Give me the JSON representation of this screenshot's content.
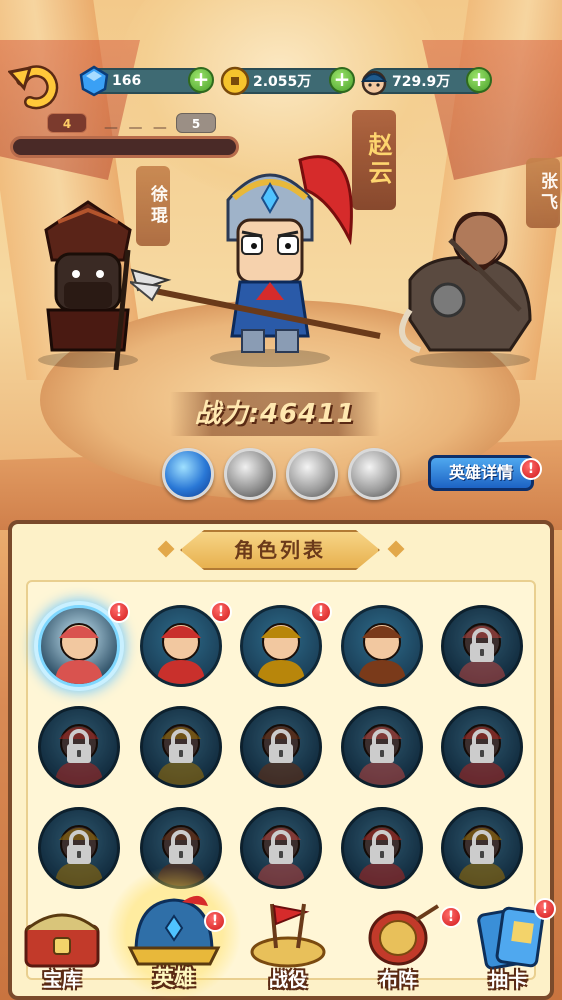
{
  "resources": [
    {
      "icon": "gem-icon",
      "value": "166"
    },
    {
      "icon": "coin-icon",
      "value": "2.055万"
    },
    {
      "icon": "soldier-icon",
      "value": "729.9万"
    }
  ],
  "level": {
    "current": "4",
    "dots": "— — —",
    "next": "5"
  },
  "heroes": {
    "center_name": "赵云",
    "left_name": "徐琨",
    "right_name": "张飞"
  },
  "power": {
    "label": "战力:",
    "value": "46411"
  },
  "skills": [
    "lightning-skill-icon",
    "whirlwind-skill-icon",
    "shield-skill-icon",
    "heal-skill-icon"
  ],
  "detail_button": "英雄详情",
  "badge_text": "!",
  "roster": {
    "title": "角色列表",
    "slots": [
      {
        "name": "hero-slot-1",
        "locked": false,
        "selected": true,
        "badge": true,
        "color": "#c9e9f7"
      },
      {
        "name": "hero-slot-2",
        "locked": false,
        "selected": false,
        "badge": true,
        "color": "#2e6b8a"
      },
      {
        "name": "hero-slot-3",
        "locked": false,
        "selected": false,
        "badge": true,
        "color": "#2e6b8a"
      },
      {
        "name": "hero-slot-4",
        "locked": false,
        "selected": false,
        "badge": false,
        "color": "#2e6b8a"
      },
      {
        "name": "hero-slot-5",
        "locked": true
      },
      {
        "name": "hero-slot-6",
        "locked": true
      },
      {
        "name": "hero-slot-7",
        "locked": true
      },
      {
        "name": "hero-slot-8",
        "locked": true
      },
      {
        "name": "hero-slot-9",
        "locked": true
      },
      {
        "name": "hero-slot-10",
        "locked": true
      },
      {
        "name": "hero-slot-11",
        "locked": true
      },
      {
        "name": "hero-slot-12",
        "locked": true
      },
      {
        "name": "hero-slot-13",
        "locked": true
      },
      {
        "name": "hero-slot-14",
        "locked": true
      },
      {
        "name": "hero-slot-15",
        "locked": true
      }
    ]
  },
  "nav": [
    {
      "label": "宝库",
      "icon": "treasure-chest-icon",
      "badge": false,
      "active": false
    },
    {
      "label": "英雄",
      "icon": "helmet-icon",
      "badge": true,
      "active": true
    },
    {
      "label": "战役",
      "icon": "battle-flag-icon",
      "badge": false,
      "active": false
    },
    {
      "label": "布阵",
      "icon": "war-drum-icon",
      "badge": true,
      "active": false
    },
    {
      "label": "抽卡",
      "icon": "cards-icon",
      "badge": true,
      "active": false
    }
  ]
}
